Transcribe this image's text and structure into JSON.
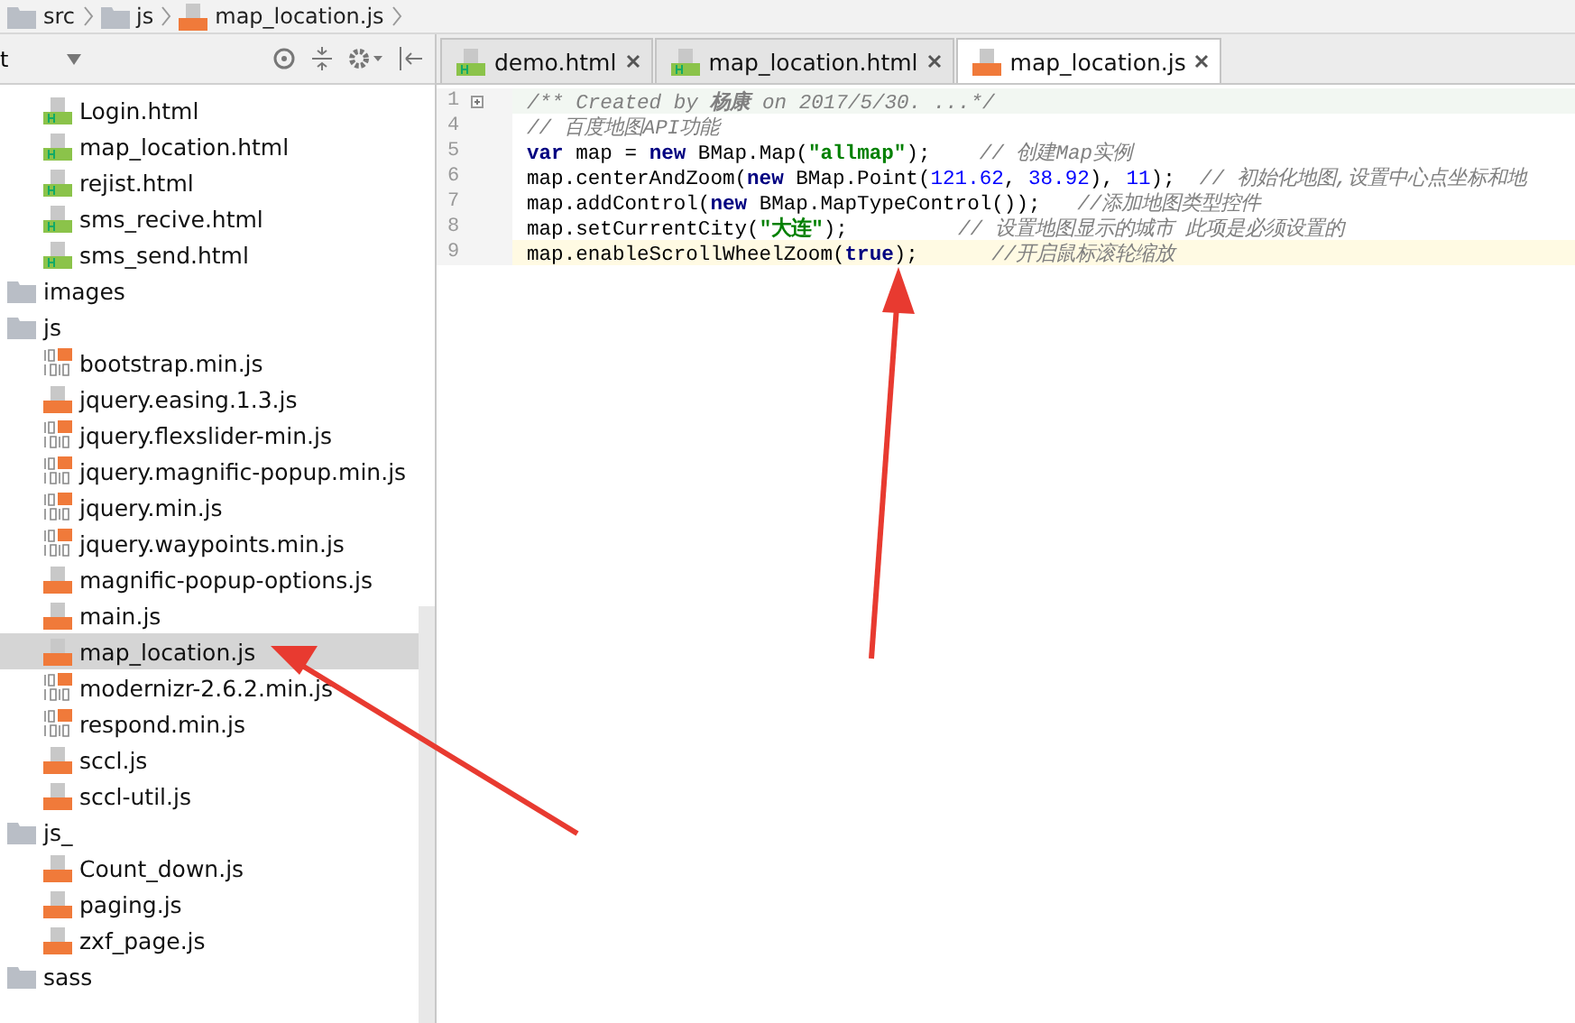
{
  "breadcrumb": [
    {
      "label": "src",
      "kind": "folder"
    },
    {
      "label": "js",
      "kind": "folder"
    },
    {
      "label": "map_location.js",
      "kind": "js"
    }
  ],
  "project_panel": {
    "title": "t",
    "tree": [
      {
        "label": "Login.html",
        "kind": "html",
        "selected": false
      },
      {
        "label": "map_location.html",
        "kind": "html",
        "selected": false
      },
      {
        "label": "rejist.html",
        "kind": "html",
        "selected": false
      },
      {
        "label": "sms_recive.html",
        "kind": "html",
        "selected": false
      },
      {
        "label": "sms_send.html",
        "kind": "html",
        "selected": false
      },
      {
        "label": "images",
        "kind": "folder",
        "selected": false
      },
      {
        "label": "js",
        "kind": "folder",
        "selected": false,
        "children": [
          {
            "label": "bootstrap.min.js",
            "kind": "jsmin",
            "selected": false
          },
          {
            "label": "jquery.easing.1.3.js",
            "kind": "js",
            "selected": false
          },
          {
            "label": "jquery.flexslider-min.js",
            "kind": "jsmin",
            "selected": false
          },
          {
            "label": "jquery.magnific-popup.min.js",
            "kind": "jsmin",
            "selected": false
          },
          {
            "label": "jquery.min.js",
            "kind": "jsmin",
            "selected": false
          },
          {
            "label": "jquery.waypoints.min.js",
            "kind": "jsmin",
            "selected": false
          },
          {
            "label": "magnific-popup-options.js",
            "kind": "js",
            "selected": false
          },
          {
            "label": "main.js",
            "kind": "js",
            "selected": false
          },
          {
            "label": "map_location.js",
            "kind": "js",
            "selected": true
          },
          {
            "label": "modernizr-2.6.2.min.js",
            "kind": "jsmin",
            "selected": false
          },
          {
            "label": "respond.min.js",
            "kind": "jsmin",
            "selected": false
          },
          {
            "label": "sccl.js",
            "kind": "js",
            "selected": false
          },
          {
            "label": "sccl-util.js",
            "kind": "js",
            "selected": false
          }
        ]
      },
      {
        "label": "js_",
        "kind": "folder",
        "selected": false,
        "children": [
          {
            "label": "Count_down.js",
            "kind": "js",
            "selected": false
          },
          {
            "label": "paging.js",
            "kind": "js",
            "selected": false
          },
          {
            "label": "zxf_page.js",
            "kind": "js",
            "selected": false
          }
        ]
      },
      {
        "label": "sass",
        "kind": "folder",
        "selected": false
      }
    ]
  },
  "tabs": [
    {
      "label": "demo.html",
      "kind": "html",
      "selected": false
    },
    {
      "label": "map_location.html",
      "kind": "html",
      "selected": false
    },
    {
      "label": "map_location.js",
      "kind": "js",
      "selected": true
    }
  ],
  "code_lines": [
    {
      "number": "1",
      "folded": true,
      "current": false,
      "tokens": [
        {
          "kind": "comment",
          "text": "/** Created by "
        },
        {
          "kind": "comment_bold",
          "text": "杨康"
        },
        {
          "kind": "comment",
          "text": " on 2017/5/30. ...*/"
        }
      ]
    },
    {
      "number": "4",
      "folded": false,
      "current": false,
      "tokens": [
        {
          "kind": "comment",
          "text": "// 百度地图API功能"
        }
      ]
    },
    {
      "number": "5",
      "folded": false,
      "current": false,
      "tokens": [
        {
          "kind": "keyword",
          "text": "var"
        },
        {
          "kind": "plain",
          "text": " map = "
        },
        {
          "kind": "keyword",
          "text": "new"
        },
        {
          "kind": "plain",
          "text": " BMap.Map("
        },
        {
          "kind": "string",
          "text": "\"allmap\""
        },
        {
          "kind": "plain",
          "text": ");    "
        },
        {
          "kind": "comment",
          "text": "// 创建Map实例"
        }
      ]
    },
    {
      "number": "6",
      "folded": false,
      "current": false,
      "tokens": [
        {
          "kind": "plain",
          "text": "map.centerAndZoom("
        },
        {
          "kind": "keyword",
          "text": "new"
        },
        {
          "kind": "plain",
          "text": " BMap.Point("
        },
        {
          "kind": "number",
          "text": "121.62"
        },
        {
          "kind": "plain",
          "text": ", "
        },
        {
          "kind": "number",
          "text": "38.92"
        },
        {
          "kind": "plain",
          "text": "), "
        },
        {
          "kind": "number",
          "text": "11"
        },
        {
          "kind": "plain",
          "text": ");  "
        },
        {
          "kind": "comment",
          "text": "// 初始化地图,设置中心点坐标和地"
        }
      ]
    },
    {
      "number": "7",
      "folded": false,
      "current": false,
      "tokens": [
        {
          "kind": "plain",
          "text": "map.addControl("
        },
        {
          "kind": "keyword",
          "text": "new"
        },
        {
          "kind": "plain",
          "text": " BMap.MapTypeControl());   "
        },
        {
          "kind": "comment",
          "text": "//添加地图类型控件"
        }
      ]
    },
    {
      "number": "8",
      "folded": false,
      "current": false,
      "tokens": [
        {
          "kind": "plain",
          "text": "map.setCurrentCity("
        },
        {
          "kind": "string",
          "text": "\"大连\""
        },
        {
          "kind": "plain",
          "text": ");         "
        },
        {
          "kind": "comment",
          "text": "// 设置地图显示的城市 此项是必须设置的"
        }
      ]
    },
    {
      "number": "9",
      "folded": false,
      "current": true,
      "tokens": [
        {
          "kind": "plain",
          "text": "map.enableScrollWheelZoom("
        },
        {
          "kind": "keyword",
          "text": "true"
        },
        {
          "kind": "plain",
          "text": ");      "
        },
        {
          "kind": "comment",
          "text": "//开启鼠标滚轮缩放"
        }
      ]
    }
  ]
}
